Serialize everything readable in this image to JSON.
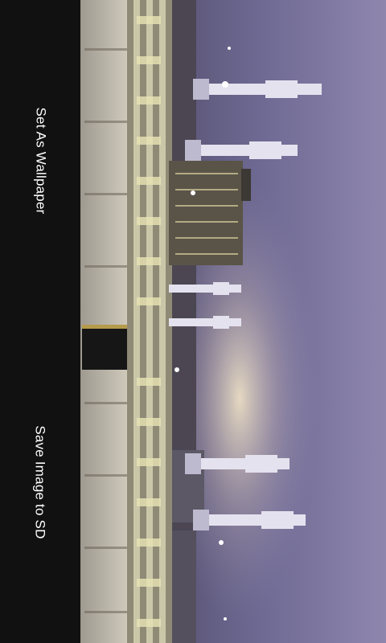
{
  "actions": {
    "set_wallpaper_label": "Set As Wallpaper",
    "save_image_label": "Save Image to SD"
  },
  "preview": {
    "colors": {
      "sky_top": "#8e86ad",
      "sky_mid": "#6f6a94",
      "horizon_glow": "#f3e6c8",
      "arcade": "#c9c7a8",
      "crowd": "#d8d2c4",
      "kaaba": "#161616",
      "minaret": "#e4e2ee"
    }
  }
}
